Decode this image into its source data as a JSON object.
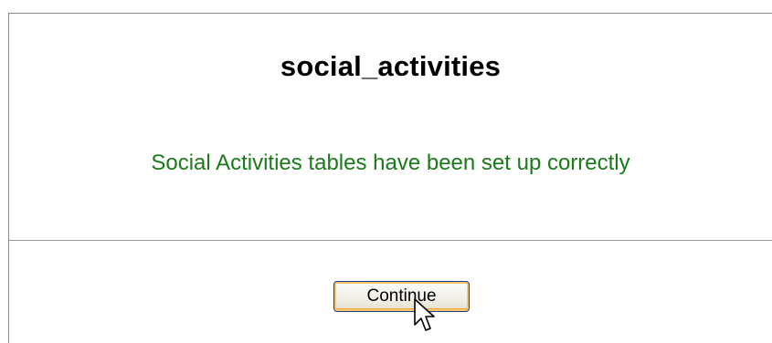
{
  "page": {
    "title": "social_activities",
    "message": "Social Activities tables have been set up correctly",
    "message_color": "#1a7a1a"
  },
  "actions": {
    "continue_label": "Continue"
  },
  "icons": {
    "cursor": "mouse-pointer-icon"
  }
}
